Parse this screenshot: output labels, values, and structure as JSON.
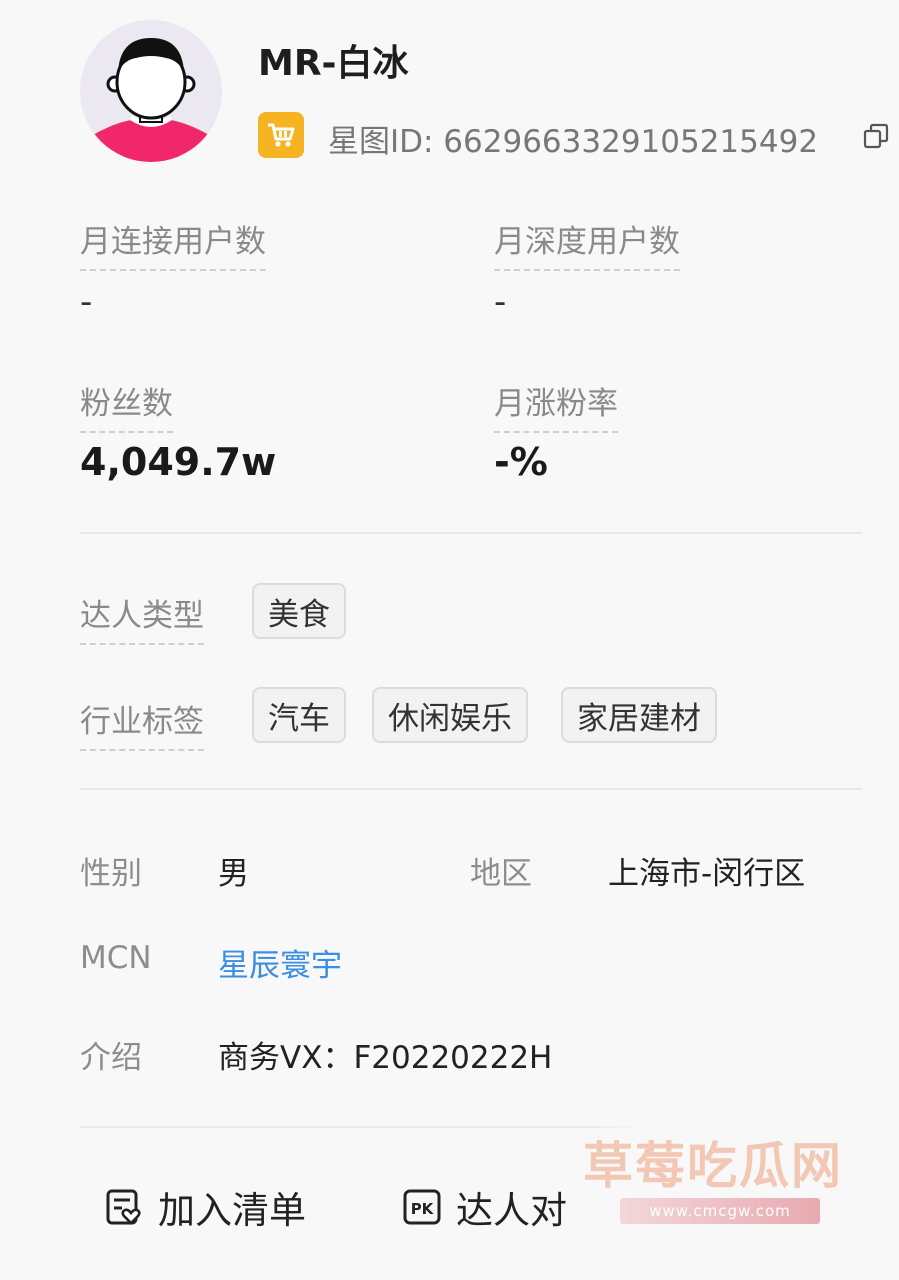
{
  "profile": {
    "name": "MR-白冰",
    "star_id_label": "星图ID: 6629663329105215492",
    "shop_icon": "cart-icon",
    "copy_icon": "copy-icon"
  },
  "stats": [
    {
      "label": "月连接用户数",
      "value": "-"
    },
    {
      "label": "月深度用户数",
      "value": "-"
    },
    {
      "label": "粉丝数",
      "value": "4,049.7w"
    },
    {
      "label": "月涨粉率",
      "value": "-%"
    }
  ],
  "talent_type": {
    "label": "达人类型",
    "tags": [
      "美食"
    ]
  },
  "industry": {
    "label": "行业标签",
    "tags": [
      "汽车",
      "休闲娱乐",
      "家居建材"
    ]
  },
  "info": {
    "gender_label": "性别",
    "gender": "男",
    "region_label": "地区",
    "region": "上海市-闵行区",
    "mcn_label": "MCN",
    "mcn": "星辰寰宇",
    "intro_label": "介绍",
    "intro": "商务VX：F20220222H"
  },
  "actions": {
    "add_list": "加入清单",
    "compare": "达人对"
  },
  "watermark": {
    "text": "草莓吃瓜网",
    "url": "www.cmcgw.com"
  },
  "colors": {
    "accent_link": "#3b8ee0",
    "badge": "#f7b422",
    "avatar_shirt": "#f0276b"
  }
}
